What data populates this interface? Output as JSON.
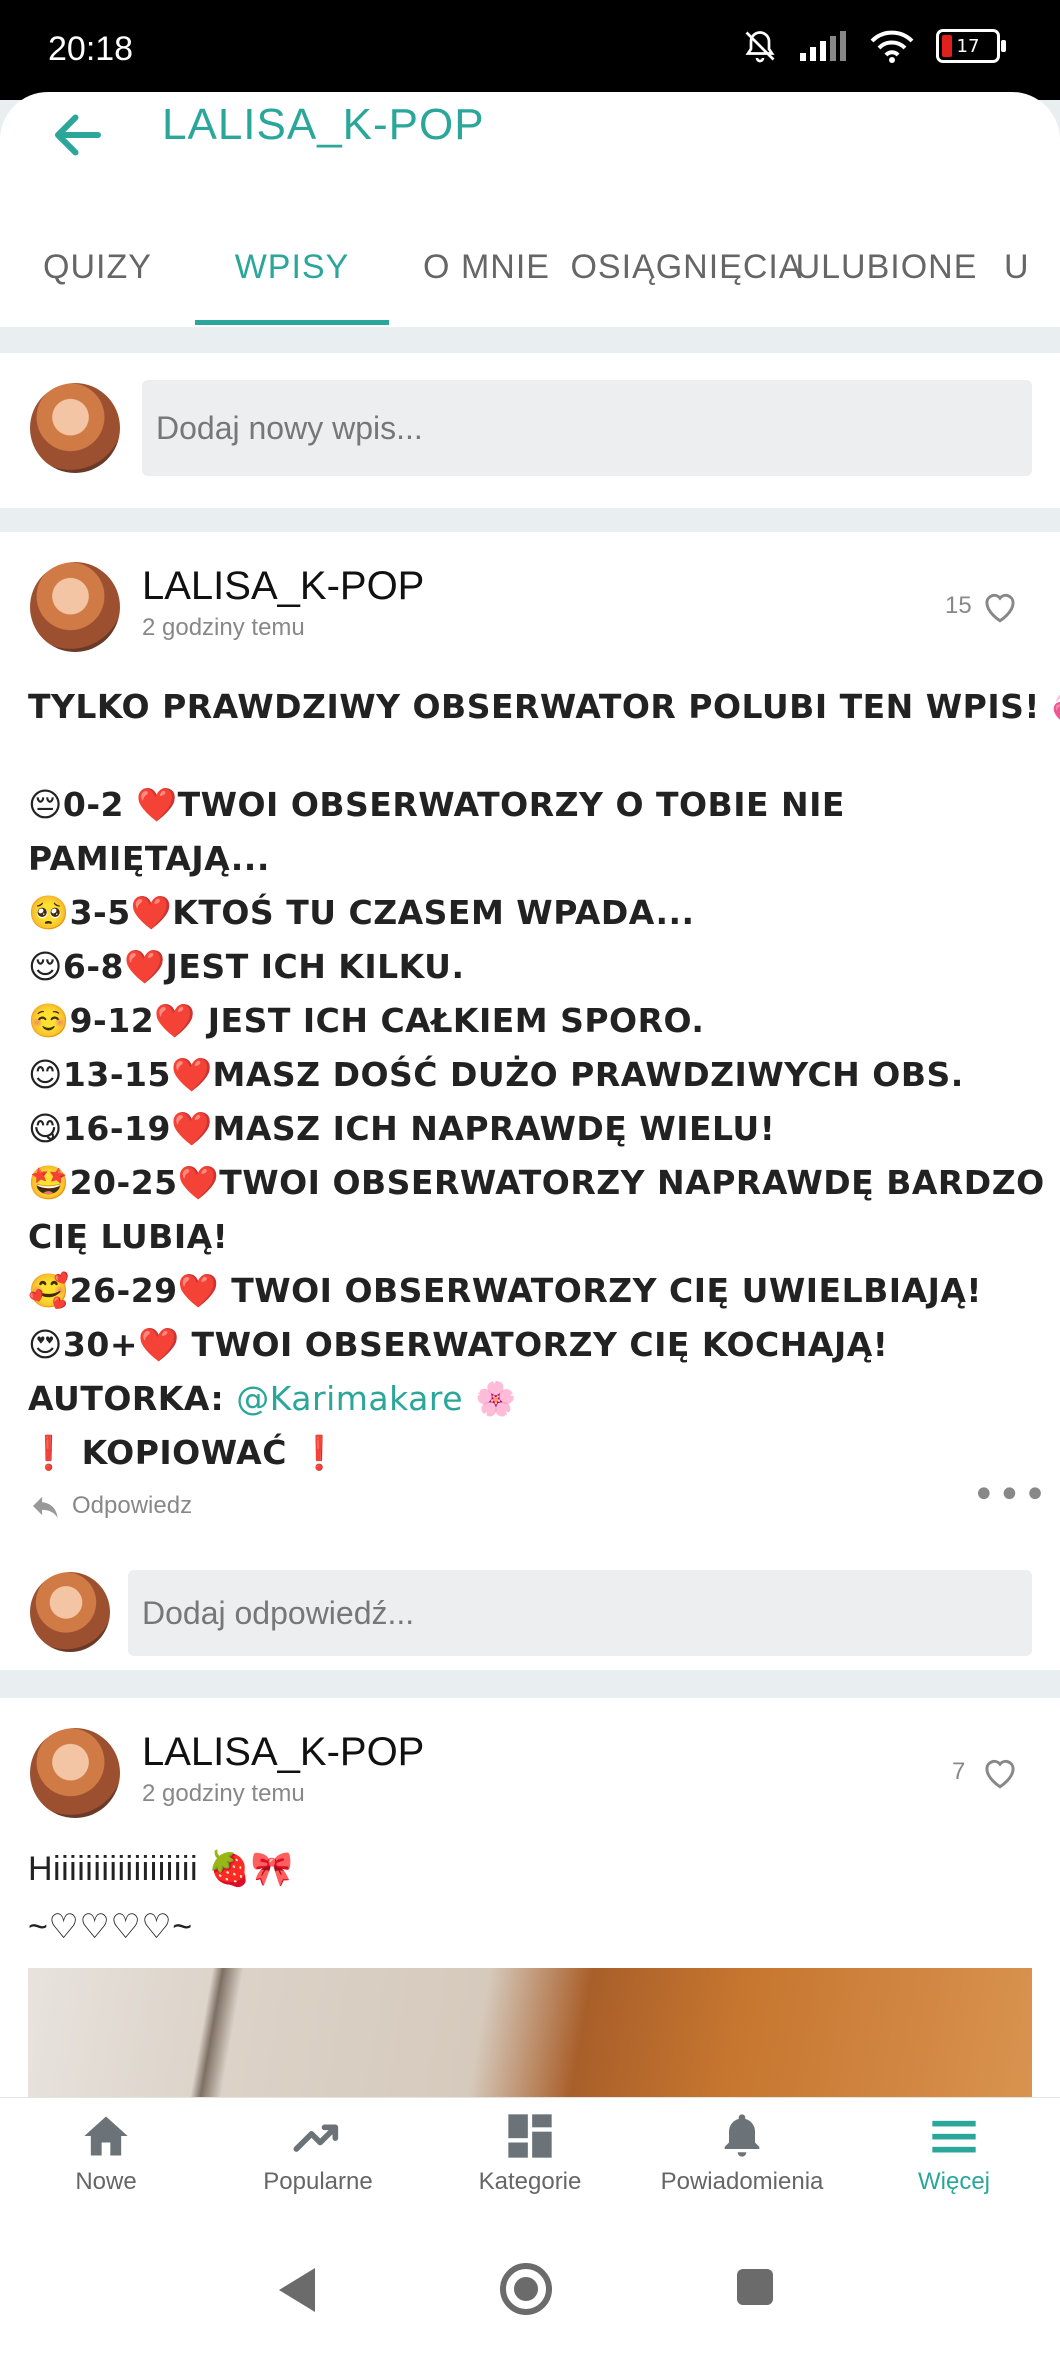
{
  "status": {
    "time": "20:18",
    "battery": "17"
  },
  "header": {
    "title": "LALISA_K-POP"
  },
  "tabs": [
    {
      "label": "QUIZY"
    },
    {
      "label": "WPISY",
      "active": true
    },
    {
      "label": "O MNIE"
    },
    {
      "label": "OSIĄGNIĘCIA"
    },
    {
      "label": "ULUBIONE"
    },
    {
      "label": "U"
    }
  ],
  "composer": {
    "placeholder": "Dodaj nowy wpis..."
  },
  "posts": [
    {
      "author": "LALISA_K-POP",
      "time": "2 godziny temu",
      "likes": "15",
      "lines": [
        "TYLKO PRAWDZIWY OBSERWATOR POLUBI TEN WPIS! 💞",
        "",
        "😔0-2 ❤️TWOI OBSERWATORZY O TOBIE NIE",
        "PAMIĘTAJĄ...",
        "🥺3-5❤️KTOŚ TU CZASEM WPADA...",
        "😌6-8❤️JEST ICH KILKU.",
        "☺️9-12❤️ JEST ICH CAŁKIEM SPORO.",
        "😊13-15❤️MASZ DOŚĆ DUŻO PRAWDZIWYCH OBS.",
        "😋16-19❤️MASZ ICH NAPRAWDĘ WIELU!",
        "🤩20-25❤️TWOI OBSERWATORZY NAPRAWDĘ BARDZO",
        "CIĘ LUBIĄ!",
        "🥰26-29❤️ TWOI OBSERWATORZY CIĘ UWIELBIAJĄ!",
        "😍30+❤️ TWOI OBSERWATORZY CIĘ KOCHAJĄ!"
      ],
      "author_credit_label": "AUTORKA: ",
      "author_credit_mention": "@Karimakare",
      "author_credit_emoji": "🌸",
      "last_line": "❗ KOPIOWAĆ ❗",
      "reply_label": "Odpowiedz",
      "reply_placeholder": "Dodaj odpowiedź..."
    },
    {
      "author": "LALISA_K-POP",
      "time": "2 godziny temu",
      "likes": "7",
      "line1": "Hiiiiiiiiiiiiiiiiii 🍓🎀",
      "line2": "~♡♡♡♡~"
    }
  ],
  "bottom_nav": [
    {
      "label": "Nowe",
      "icon": "home-icon"
    },
    {
      "label": "Popularne",
      "icon": "trending-icon"
    },
    {
      "label": "Kategorie",
      "icon": "categories-icon"
    },
    {
      "label": "Powiadomienia",
      "icon": "bell-icon"
    },
    {
      "label": "Więcej",
      "icon": "menu-icon",
      "active": true
    }
  ],
  "colors": {
    "accent": "#2aa69a"
  }
}
